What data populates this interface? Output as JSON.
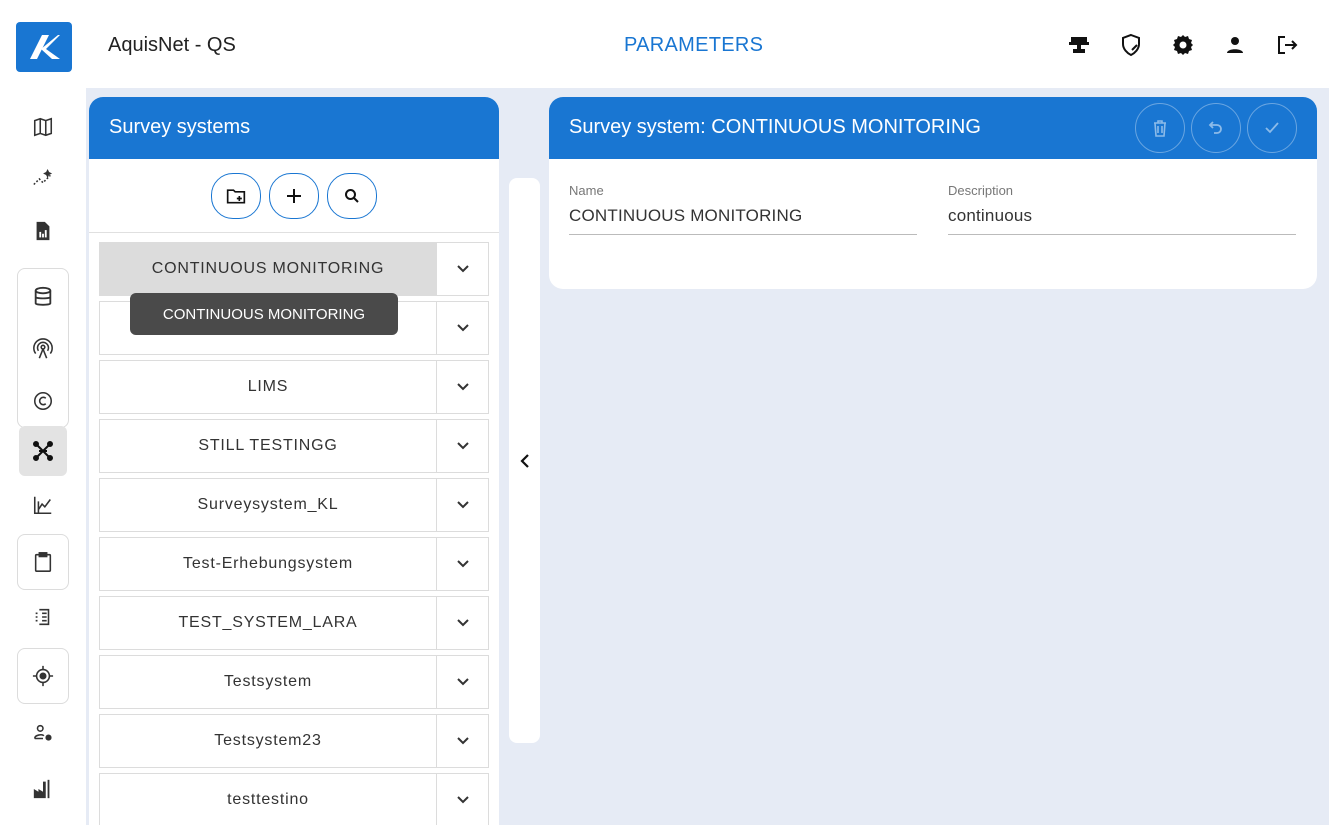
{
  "header": {
    "app_title": "AquisNet - QS",
    "page_title": "PARAMETERS",
    "icons": [
      "tools-icon",
      "shield-edit-icon",
      "gear-icon",
      "user-icon",
      "logout-icon"
    ]
  },
  "rail": {
    "items": [
      "map-icon",
      "trend-icon",
      "report-icon",
      "database-icon",
      "antenna-icon",
      "copyright-icon",
      "network-icon",
      "chart-icon",
      "clipboard-icon",
      "list-icon",
      "target-icon",
      "user-settings-icon",
      "factory-icon"
    ],
    "active": "network-icon"
  },
  "left_panel": {
    "title": "Survey systems",
    "tooltip": "CONTINUOUS MONITORING",
    "systems": [
      "CONTINUOUS MONITORING",
      "",
      "LIMS",
      "STILL TESTINGG",
      "Surveysystem_KL",
      "Test-Erhebungsystem",
      "TEST_SYSTEM_LARA",
      "Testsystem",
      "Testsystem23",
      "testtestino"
    ]
  },
  "detail": {
    "title": "Survey system: CONTINUOUS MONITORING",
    "name_label": "Name",
    "name_value": "CONTINUOUS MONITORING",
    "description_label": "Description",
    "description_value": "continuous"
  },
  "colors": {
    "primary": "#1976d2",
    "background": "#e6ebf5"
  }
}
